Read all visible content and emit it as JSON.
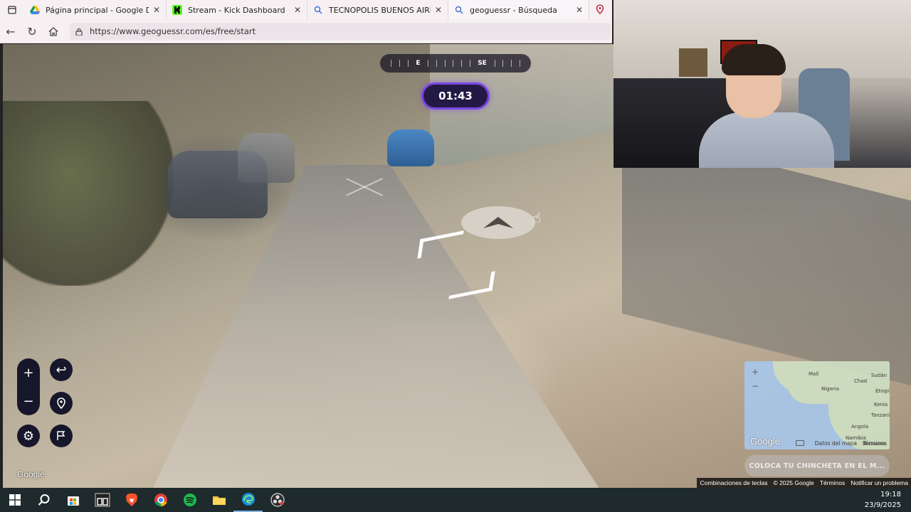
{
  "browser": {
    "tabs": [
      {
        "title": "Página principal - Google Drive",
        "icon": "google-drive-icon"
      },
      {
        "title": "Stream - Kick Dashboard",
        "icon": "kick-icon"
      },
      {
        "title": "TECNOPOLIS BUENOS AIRES MAP",
        "icon": "search-icon"
      },
      {
        "title": "geoguessr - Búsqueda",
        "icon": "search-icon"
      }
    ],
    "url": "https://www.geoguessr.com/es/free/start"
  },
  "game": {
    "compass": {
      "left": "E",
      "right": "SE"
    },
    "timer": "01:43",
    "google_logo": "Google",
    "minimap": {
      "labels": [
        "Mali",
        "Sudán",
        "Chad",
        "Nigeria",
        "Etiopí",
        "Kenia",
        "Tanzani",
        "Angola",
        "Namibia",
        "Botsuana"
      ],
      "zoom_in": "+",
      "zoom_out": "−",
      "google_logo": "Google",
      "data_text": "Datos del mapa",
      "terms_text": "Términos"
    },
    "pin_button": "COLOCA TU CHINCHETA EN EL M...",
    "attribution": {
      "shortcuts": "Combinaciones de teclas",
      "copyright": "© 2025 Google",
      "terms": "Términos",
      "report": "Notificar un problema"
    }
  },
  "taskbar": {
    "time": "19:18",
    "date": "23/9/2025"
  }
}
